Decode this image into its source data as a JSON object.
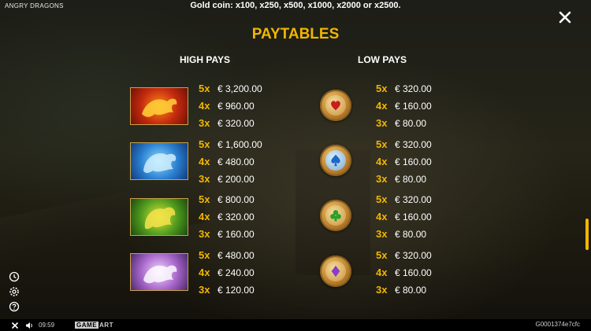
{
  "game": {
    "title": "ANGRY DRAGONS"
  },
  "info": {
    "gold_coin": "Gold coin: x100, x250, x500, x1000, x2000 or x2500."
  },
  "heading": "PAYTABLES",
  "high_pays": {
    "label": "HIGH PAYS",
    "symbols": [
      {
        "icon": "red-dragon-icon",
        "pays": [
          {
            "mult": "5x",
            "value": "€ 3,200.00"
          },
          {
            "mult": "4x",
            "value": "€ 960.00"
          },
          {
            "mult": "3x",
            "value": "€ 320.00"
          }
        ]
      },
      {
        "icon": "blue-dragon-icon",
        "pays": [
          {
            "mult": "5x",
            "value": "€ 1,600.00"
          },
          {
            "mult": "4x",
            "value": "€ 480.00"
          },
          {
            "mult": "3x",
            "value": "€ 200.00"
          }
        ]
      },
      {
        "icon": "green-dragon-icon",
        "pays": [
          {
            "mult": "5x",
            "value": "€ 800.00"
          },
          {
            "mult": "4x",
            "value": "€ 320.00"
          },
          {
            "mult": "3x",
            "value": "€ 160.00"
          }
        ]
      },
      {
        "icon": "purple-dragon-icon",
        "pays": [
          {
            "mult": "5x",
            "value": "€ 480.00"
          },
          {
            "mult": "4x",
            "value": "€ 240.00"
          },
          {
            "mult": "3x",
            "value": "€ 120.00"
          }
        ]
      }
    ]
  },
  "low_pays": {
    "label": "LOW PAYS",
    "symbols": [
      {
        "icon": "heart-coin-icon",
        "pays": [
          {
            "mult": "5x",
            "value": "€ 320.00"
          },
          {
            "mult": "4x",
            "value": "€ 160.00"
          },
          {
            "mult": "3x",
            "value": "€ 80.00"
          }
        ]
      },
      {
        "icon": "spade-coin-icon",
        "pays": [
          {
            "mult": "5x",
            "value": "€ 320.00"
          },
          {
            "mult": "4x",
            "value": "€ 160.00"
          },
          {
            "mult": "3x",
            "value": "€ 80.00"
          }
        ]
      },
      {
        "icon": "club-coin-icon",
        "pays": [
          {
            "mult": "5x",
            "value": "€ 320.00"
          },
          {
            "mult": "4x",
            "value": "€ 160.00"
          },
          {
            "mult": "3x",
            "value": "€ 80.00"
          }
        ]
      },
      {
        "icon": "diamond-coin-icon",
        "pays": [
          {
            "mult": "5x",
            "value": "€ 320.00"
          },
          {
            "mult": "4x",
            "value": "€ 160.00"
          },
          {
            "mult": "3x",
            "value": "€ 80.00"
          }
        ]
      }
    ]
  },
  "bottom_bar": {
    "time": "09:59",
    "logo_game": "GAME",
    "logo_art": "ART",
    "session_id": "G0001374e7cfc"
  },
  "colors": {
    "accent": "#f2b600",
    "text": "#ffffff",
    "bar": "#000000"
  }
}
